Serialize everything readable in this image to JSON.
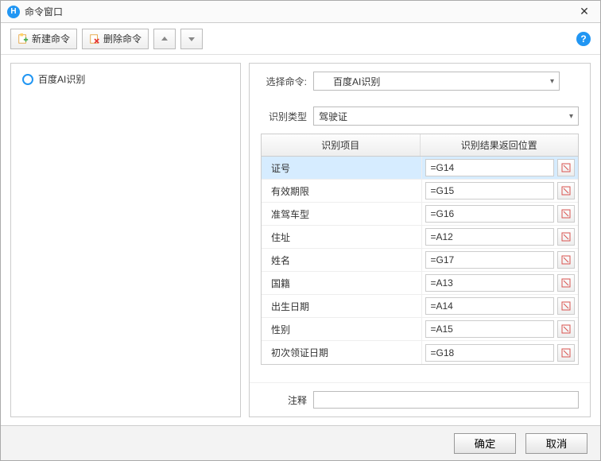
{
  "titlebar": {
    "title": "命令窗口",
    "close": "✕",
    "app_letter": "H"
  },
  "toolbar": {
    "new_label": "新建命令",
    "delete_label": "删除命令",
    "help_tooltip": "?"
  },
  "tree": {
    "items": [
      {
        "label": "百度AI识别"
      }
    ]
  },
  "form": {
    "select_command_label": "选择命令:",
    "selected_command": "百度AI识别",
    "recog_type_label": "识别类型",
    "recog_type_value": "驾驶证",
    "note_label": "注释",
    "note_value": ""
  },
  "table": {
    "headers": {
      "col1": "识别项目",
      "col2": "识别结果返回位置"
    },
    "rows": [
      {
        "item": "证号",
        "pos": "=G14",
        "selected": true
      },
      {
        "item": "有效期限",
        "pos": "=G15",
        "selected": false
      },
      {
        "item": "准驾车型",
        "pos": "=G16",
        "selected": false
      },
      {
        "item": "住址",
        "pos": "=A12",
        "selected": false
      },
      {
        "item": "姓名",
        "pos": "=G17",
        "selected": false
      },
      {
        "item": "国籍",
        "pos": "=A13",
        "selected": false
      },
      {
        "item": "出生日期",
        "pos": "=A14",
        "selected": false
      },
      {
        "item": "性别",
        "pos": "=A15",
        "selected": false
      },
      {
        "item": "初次领证日期",
        "pos": "=G18",
        "selected": false
      }
    ]
  },
  "footer": {
    "ok": "确定",
    "cancel": "取消"
  }
}
